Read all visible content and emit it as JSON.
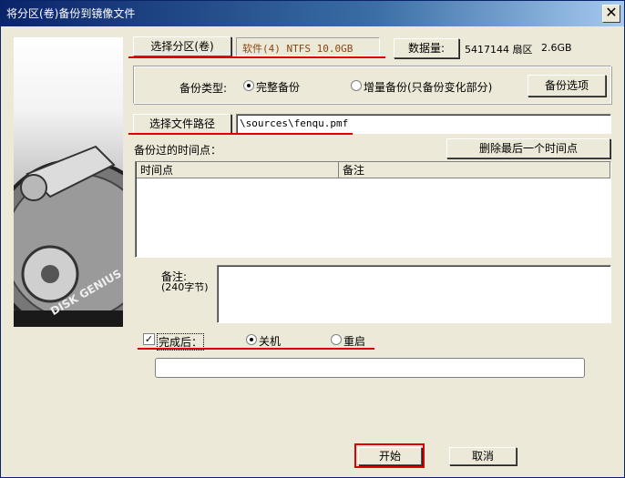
{
  "window": {
    "title": "将分区(卷)备份到镜像文件",
    "close_glyph": "✕"
  },
  "partition": {
    "select_button": "选择分区(卷)",
    "value": "软件(4) NTFS 10.0GB",
    "data_size_button": "数据量:",
    "sectors": "5417144 扇区",
    "size": "2.6GB"
  },
  "backup_type": {
    "label": "备份类型:",
    "options": [
      "完整备份",
      "增量备份(只备份变化部分)"
    ],
    "selected": 0,
    "options_button": "备份选项"
  },
  "file_path": {
    "select_button": "选择文件路径",
    "value": "\\sources\\fenqu.pmf"
  },
  "timepoints": {
    "label": "备份过的时间点：",
    "delete_last_button": "删除最后一个时间点",
    "columns": [
      "时间点",
      "备注"
    ],
    "rows": []
  },
  "note": {
    "label": "备注:",
    "limit": "(240字节)",
    "value": ""
  },
  "after_complete": {
    "label": "完成后：",
    "checked": true,
    "options": [
      "关机",
      "重启"
    ],
    "selected": 0
  },
  "progress": {
    "value": 0
  },
  "footer": {
    "start_button": "开始",
    "cancel_button": "取消"
  },
  "logo": {
    "text": "DISK GENIUS"
  },
  "colors": {
    "accent_red": "#e00000",
    "title_blue": "#0a246a",
    "partition_text": "#8b4513"
  }
}
